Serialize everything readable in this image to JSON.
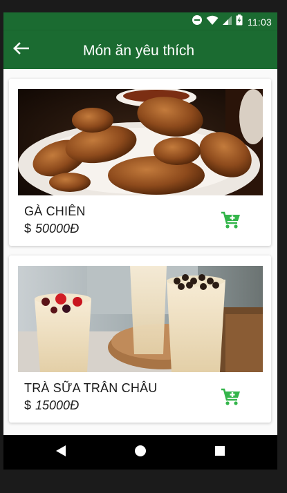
{
  "status_bar": {
    "time": "11:03",
    "icons": [
      "do-not-disturb-icon",
      "wifi-icon",
      "cell-signal-icon",
      "battery-charging-icon"
    ]
  },
  "app_bar": {
    "title": "Món ăn yêu thích",
    "back_icon": "arrow-back-icon"
  },
  "favorites": [
    {
      "name": "GÀ CHIÊN",
      "currency_symbol": "$",
      "price": "50000Đ",
      "image": "fried-chicken-photo",
      "action_icon": "add-to-cart-icon"
    },
    {
      "name": "TRÀ SỮA TRÂN CHÂU",
      "currency_symbol": "$",
      "price": "15000Đ",
      "image": "bubble-milk-tea-photo",
      "action_icon": "add-to-cart-icon"
    }
  ],
  "nav_bar": {
    "buttons": [
      "back-triangle-icon",
      "home-circle-icon",
      "recents-square-icon"
    ]
  },
  "colors": {
    "primary": "#1b6b31",
    "cart_icon": "#33b54a",
    "nav_bar": "#000000"
  }
}
